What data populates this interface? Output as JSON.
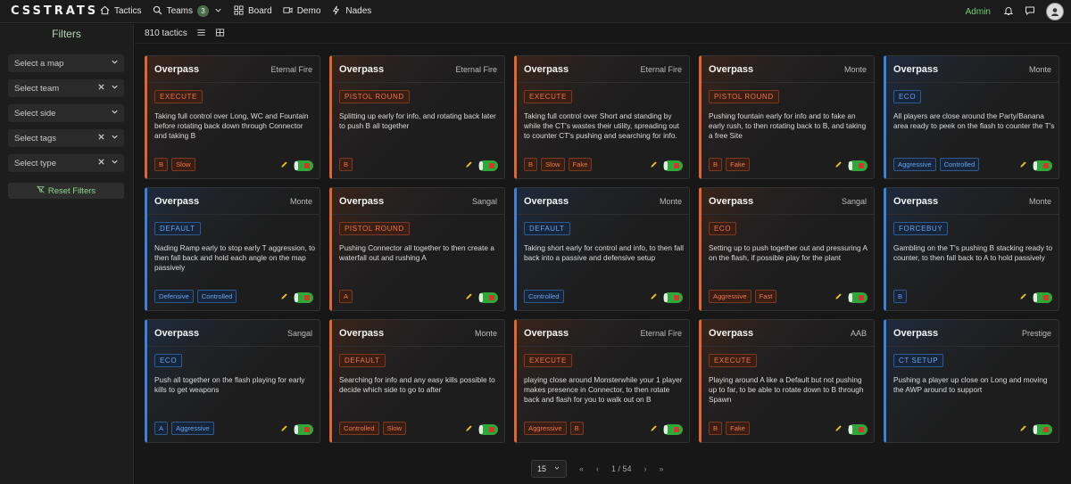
{
  "app": {
    "logo": "CSSTRATS"
  },
  "nav": {
    "tactics": "Tactics",
    "teams": "Teams",
    "teams_badge": "3",
    "board": "Board",
    "demo": "Demo",
    "nades": "Nades",
    "user": "Admin"
  },
  "sidebar": {
    "title": "Filters",
    "filters": [
      {
        "placeholder": "Select a map",
        "clearable": false
      },
      {
        "placeholder": "Select team",
        "clearable": true
      },
      {
        "placeholder": "Select side",
        "clearable": false
      },
      {
        "placeholder": "Select tags",
        "clearable": true
      },
      {
        "placeholder": "Select type",
        "clearable": true
      }
    ],
    "reset_label": "Reset Filters"
  },
  "toolbar": {
    "count": "810 tactics"
  },
  "cards": [
    {
      "side": "t",
      "map": "Overpass",
      "team": "Eternal Fire",
      "type": "EXECUTE",
      "desc": "Taking full control over Long, WC and Fountain before rotating back down through Connector and taking B",
      "tags": [
        "B",
        "Slow"
      ]
    },
    {
      "side": "t",
      "map": "Overpass",
      "team": "Eternal Fire",
      "type": "PISTOL ROUND",
      "desc": "Splitting up early for info, and rotating back later to push B all together",
      "tags": [
        "B"
      ]
    },
    {
      "side": "t",
      "map": "Overpass",
      "team": "Eternal Fire",
      "type": "EXECUTE",
      "desc": "Taking full control over Short and standing by while the CT's wastes their utility, spreading out to counter CT's pushing and searching for info. When ready you fake…",
      "tags": [
        "B",
        "Slow",
        "Fake"
      ]
    },
    {
      "side": "t",
      "map": "Overpass",
      "team": "Monte",
      "type": "PISTOL ROUND",
      "desc": "Pushing fountain early for info and to fake an early rush, to then rotating back to B, and taking a free Site",
      "tags": [
        "B",
        "Fake"
      ]
    },
    {
      "side": "ct",
      "map": "Overpass",
      "team": "Monte",
      "type": "ECO",
      "desc": "All players are close around the Party/Banana area ready to peek on the flash to counter the T's",
      "tags": [
        "Aggressive",
        "Controlled"
      ]
    },
    {
      "side": "ct",
      "map": "Overpass",
      "team": "Monte",
      "type": "DEFAULT",
      "desc": "Nading Ramp early to stop early T aggression, to then fall back and hold each angle on the map passively",
      "tags": [
        "Defensive",
        "Controlled"
      ]
    },
    {
      "side": "t",
      "map": "Overpass",
      "team": "Sangal",
      "type": "PISTOL ROUND",
      "desc": "Pushing Connector all together to then create a waterfall out and rushing A",
      "tags": [
        "A"
      ]
    },
    {
      "side": "ct",
      "map": "Overpass",
      "team": "Monte",
      "type": "DEFAULT",
      "desc": "Taking short early for control and info, to then fall back into a passive and defensive setup",
      "tags": [
        "Controlled"
      ]
    },
    {
      "side": "t",
      "map": "Overpass",
      "team": "Sangal",
      "type": "ECO",
      "desc": "Setting up to push together out and pressuring A on the flash, if possible play for the plant",
      "tags": [
        "Aggressive",
        "Fast"
      ]
    },
    {
      "side": "ct",
      "map": "Overpass",
      "team": "Monte",
      "type": "FORCEBUY",
      "desc": "Gambling on the T's pushing B stacking ready to counter, to then fall back to A to hold passively",
      "tags": [
        "B"
      ]
    },
    {
      "side": "ct",
      "map": "Overpass",
      "team": "Sangal",
      "type": "ECO",
      "desc": "Push all together on the flash playing for early kills to get weapons",
      "tags": [
        "A",
        "Aggressive"
      ]
    },
    {
      "side": "t",
      "map": "Overpass",
      "team": "Monte",
      "type": "DEFAULT",
      "desc": "Searching for info and any easy kills possible to decide which side to go to after",
      "tags": [
        "Controlled",
        "Slow"
      ]
    },
    {
      "side": "t",
      "map": "Overpass",
      "team": "Eternal Fire",
      "type": "EXECUTE",
      "desc": "playing close around Monsterwhile your 1 player makes presence in Connector, to then rotate back and flash for you to walk out on B",
      "tags": [
        "Aggressive",
        "B"
      ]
    },
    {
      "side": "t",
      "map": "Overpass",
      "team": "AAB",
      "type": "EXECUTE",
      "desc": "Playing around A like a Default but not pushing up to far, to be able to rotate down to B through Spawn",
      "tags": [
        "B",
        "Fake"
      ]
    },
    {
      "side": "ct",
      "map": "Overpass",
      "team": "Prestige",
      "type": "CT SETUP",
      "desc": "Pushing a player up close on Long and moving the AWP around to support",
      "tags": []
    }
  ],
  "pagination": {
    "page_size": "15",
    "page_info": "1 / 54"
  },
  "colors": {
    "t_side": "#e0652e",
    "ct_side": "#3f7fd6",
    "accent": "#6fcf6f",
    "toggle_on": "#2fa83a"
  }
}
